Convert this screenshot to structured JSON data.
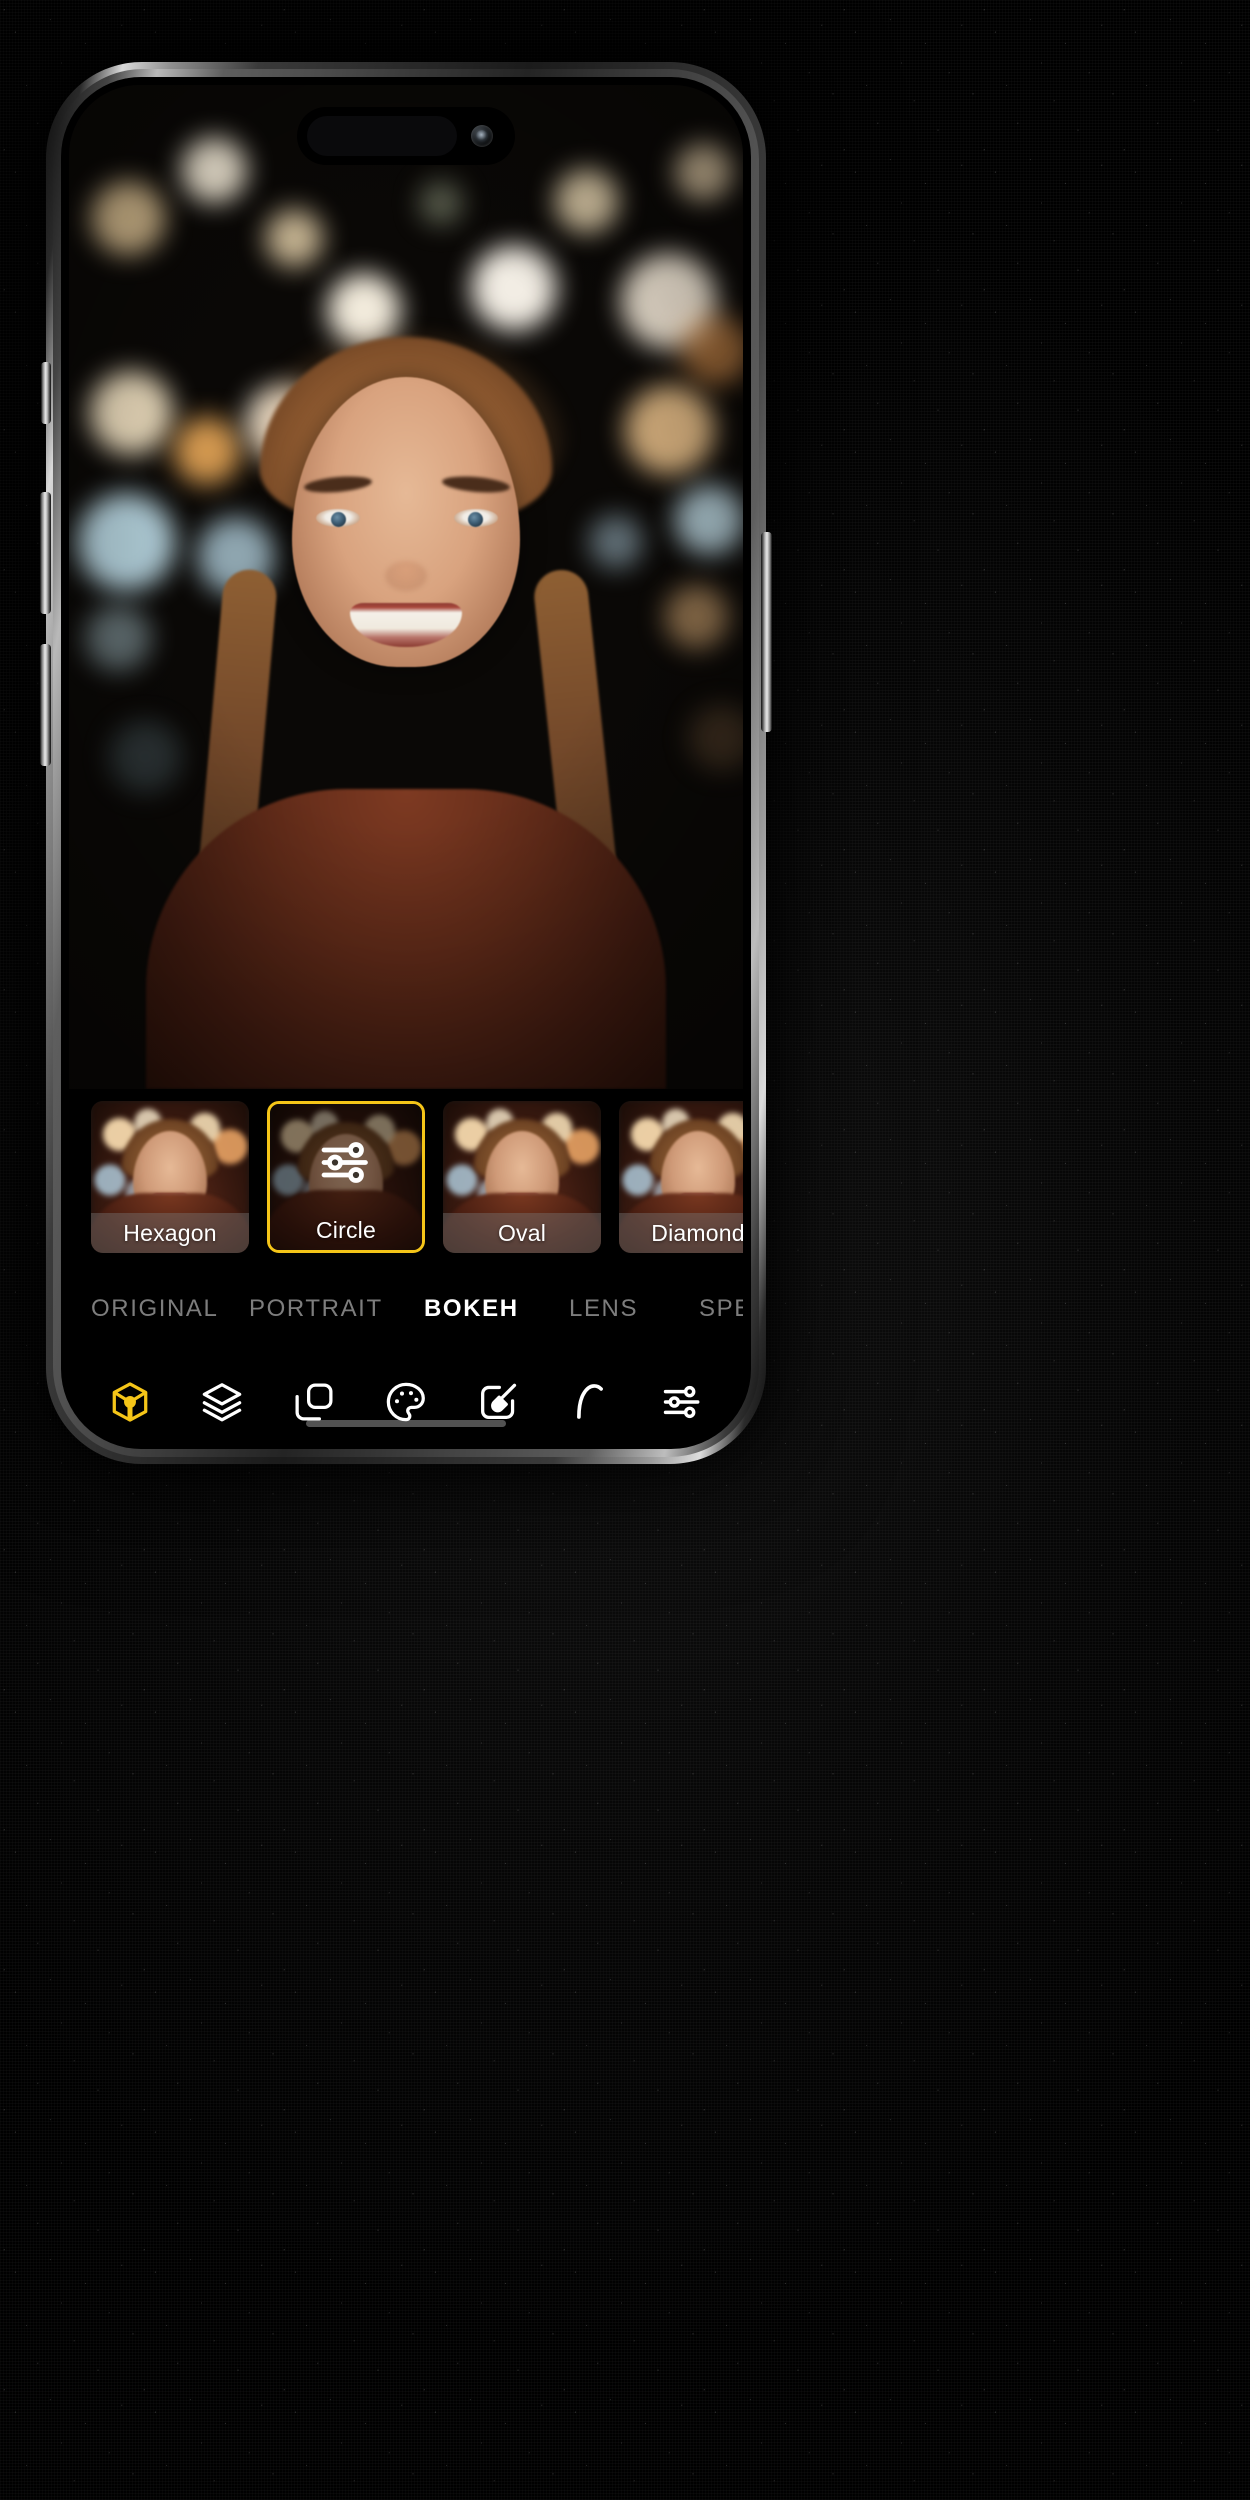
{
  "device": {
    "name": "smartphone-mockup",
    "frame_color": "#c8c8c8",
    "screen_background": "#000000"
  },
  "status": {
    "dynamic_island": "dynamic-island",
    "front_camera": "front-camera-lens"
  },
  "photo": {
    "alt": "Smiling young woman with braided hair, bokeh city lights at night",
    "subject_label": "portrait-photo-canvas"
  },
  "accent_color": "#F5C518",
  "filter_strip": {
    "name": "bokeh-shape-filter-strip",
    "items": [
      {
        "label": "Hexagon",
        "selected": false
      },
      {
        "label": "Circle",
        "selected": true,
        "icon": "sliders-icon"
      },
      {
        "label": "Oval",
        "selected": false
      },
      {
        "label": "Diamond",
        "selected": false
      }
    ]
  },
  "tabs": {
    "name": "effect-category-tabs",
    "items": [
      {
        "label": "ORIGINAL",
        "active": false
      },
      {
        "label": "PORTRAIT",
        "active": false
      },
      {
        "label": "BOKEH",
        "active": true
      },
      {
        "label": "LENS",
        "active": false
      },
      {
        "label": "SPECIAL",
        "active": false
      }
    ]
  },
  "toolbar": {
    "name": "bottom-tool-bar",
    "items": [
      {
        "icon": "cube-3d-icon",
        "active": true
      },
      {
        "icon": "layers-icon",
        "active": false
      },
      {
        "icon": "duplicate-icon",
        "active": false
      },
      {
        "icon": "palette-icon",
        "active": false
      },
      {
        "icon": "brush-frame-icon",
        "active": false
      },
      {
        "icon": "curve-icon",
        "active": false
      },
      {
        "icon": "adjust-sliders-icon",
        "active": false
      }
    ]
  }
}
